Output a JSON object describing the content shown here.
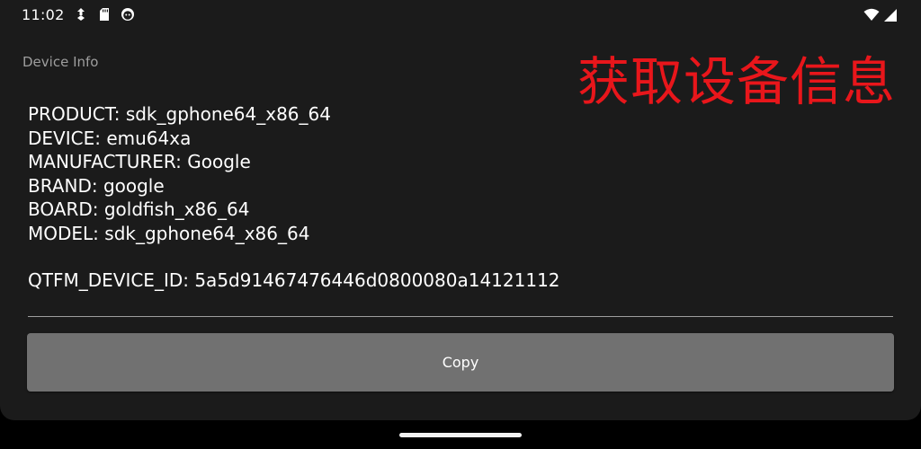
{
  "status_bar": {
    "time": "11:02",
    "left_icons": [
      "download-icon",
      "sd-card-icon",
      "face-icon"
    ],
    "right_icons": [
      "wifi-icon",
      "signal-icon"
    ]
  },
  "page": {
    "title": "Device Info",
    "headline": "获取设备信息",
    "headline_color": "#e8161b"
  },
  "device_info": {
    "lines": [
      "PRODUCT: sdk_gphone64_x86_64",
      "DEVICE: emu64xa",
      "MANUFACTURER: Google",
      "BRAND: google",
      "BOARD: goldfish_x86_64",
      "MODEL: sdk_gphone64_x86_64"
    ],
    "device_id": "QTFM_DEVICE_ID: 5a5d91467476446d0800080a14121112"
  },
  "actions": {
    "copy_label": "Copy",
    "copy_color": "#717171"
  }
}
